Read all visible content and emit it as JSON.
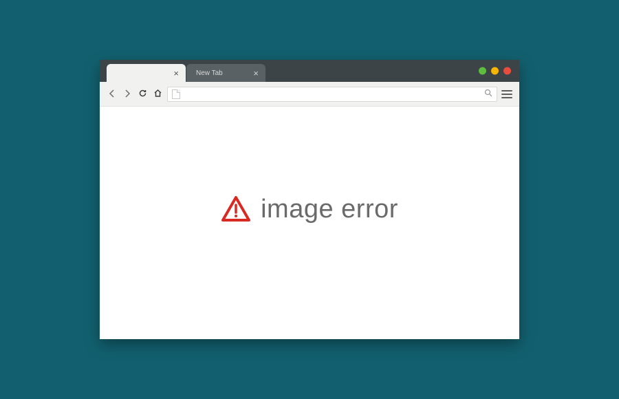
{
  "tabs": {
    "active_label": "",
    "inactive_label": "New Tab"
  },
  "address_bar": {
    "value": "",
    "placeholder": ""
  },
  "content": {
    "error_message": "image error"
  },
  "colors": {
    "background": "#12606f",
    "warning": "#d82a22",
    "text_muted": "#6a6a6a"
  }
}
